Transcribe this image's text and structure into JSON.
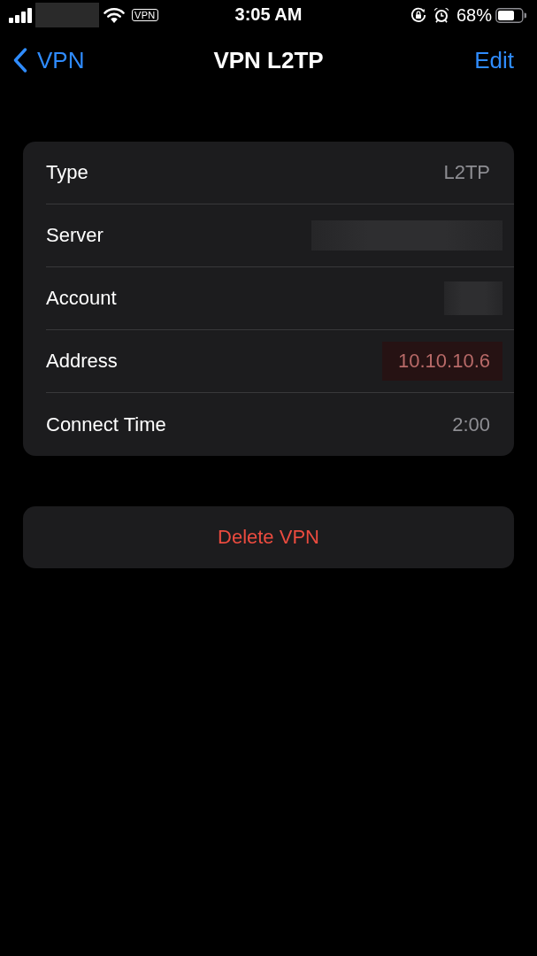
{
  "status_bar": {
    "vpn_badge": "VPN",
    "time": "3:05 AM",
    "battery_percent": "68%"
  },
  "nav_bar": {
    "back_label": "VPN",
    "title": "VPN L2TP",
    "action": "Edit"
  },
  "details": {
    "rows": [
      {
        "label": "Type",
        "kind": "text",
        "value": "L2TP"
      },
      {
        "label": "Server",
        "kind": "redacted",
        "wide": true
      },
      {
        "label": "Account",
        "kind": "redacted",
        "wide": false
      },
      {
        "label": "Address",
        "kind": "highlight",
        "value": "10.10.10.6"
      },
      {
        "label": "Connect Time",
        "kind": "text",
        "value": "2:00"
      }
    ]
  },
  "delete_button": "Delete VPN"
}
